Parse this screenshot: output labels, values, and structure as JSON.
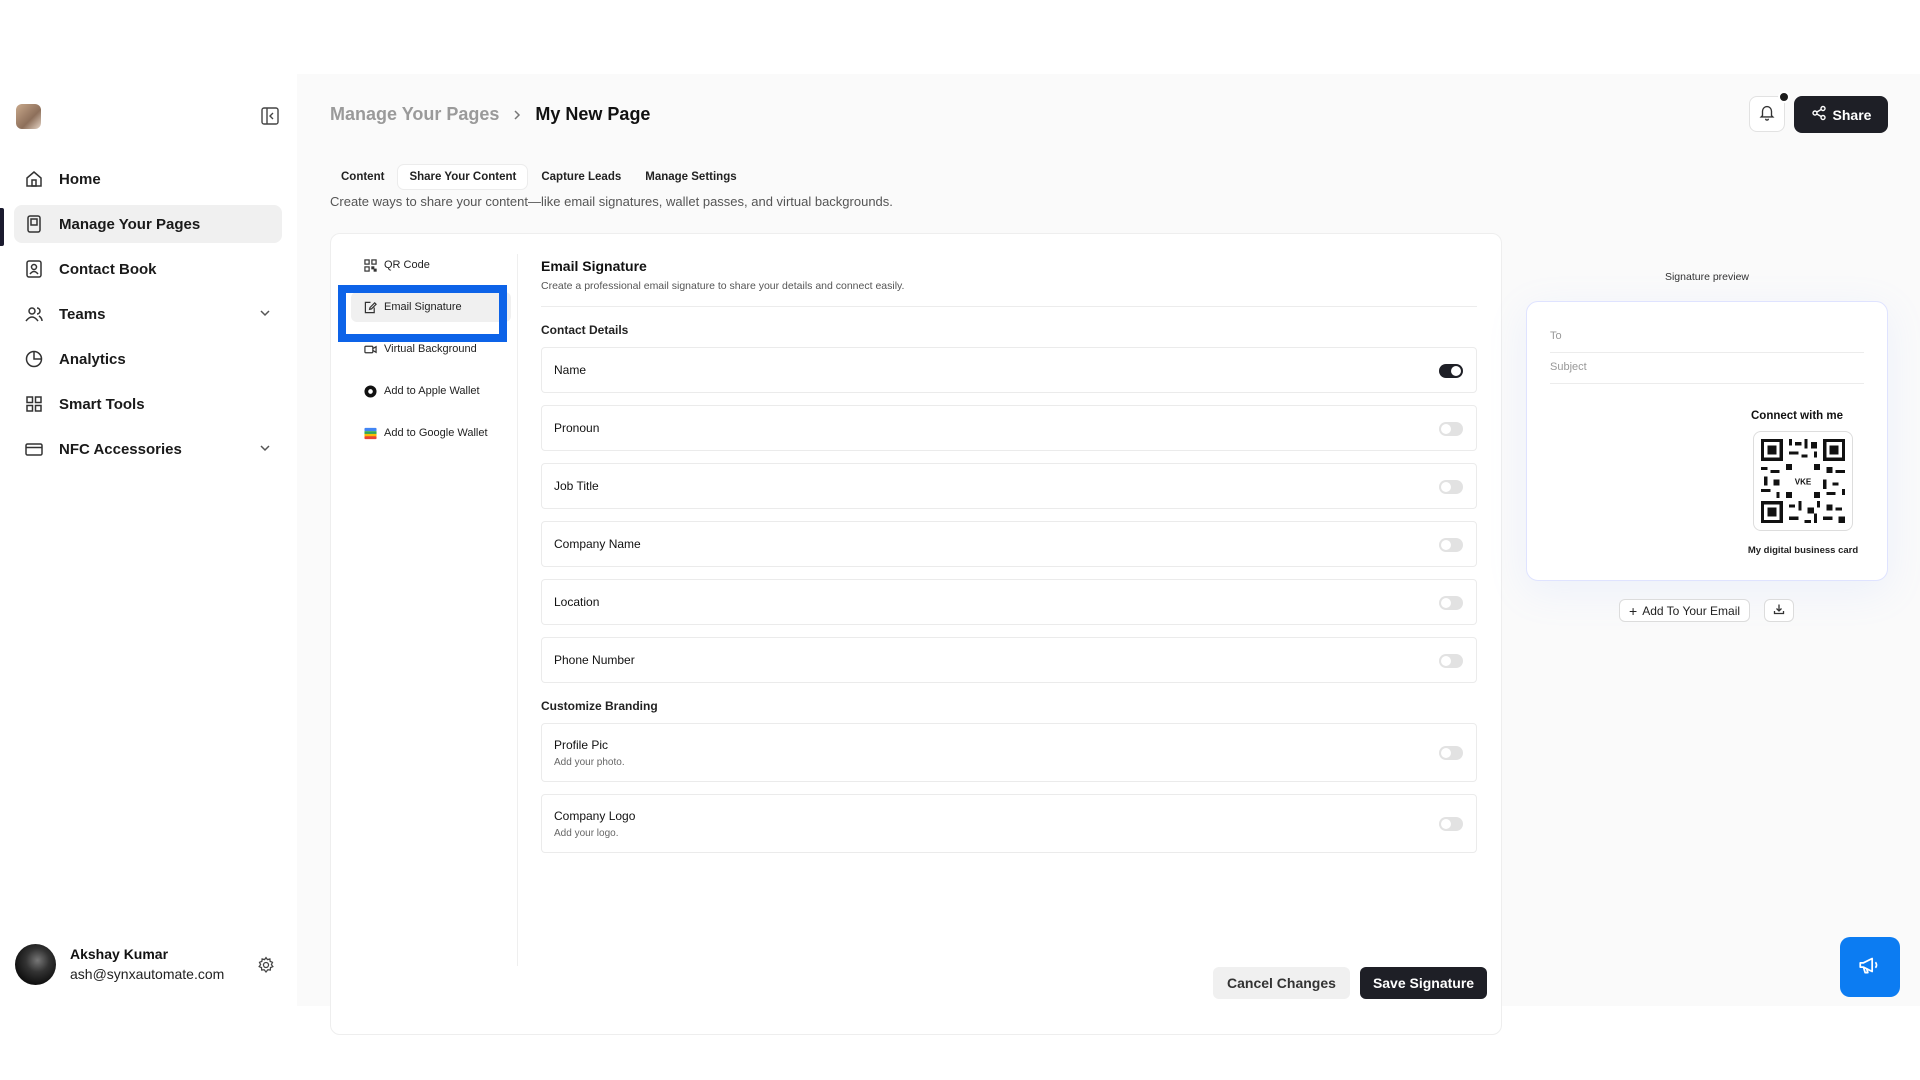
{
  "sidebar": {
    "items": [
      {
        "label": "Home",
        "icon": "home-icon"
      },
      {
        "label": "Manage Your Pages",
        "icon": "pages-icon"
      },
      {
        "label": "Contact Book",
        "icon": "contact-book-icon"
      },
      {
        "label": "Teams",
        "icon": "users-icon"
      },
      {
        "label": "Analytics",
        "icon": "analytics-icon"
      },
      {
        "label": "Smart Tools",
        "icon": "grid-icon"
      },
      {
        "label": "NFC Accessories",
        "icon": "card-icon"
      }
    ],
    "user": {
      "name": "Akshay Kumar",
      "email": "ash@synxautomate.com"
    }
  },
  "header": {
    "breadcrumb_parent": "Manage Your Pages",
    "breadcrumb_current": "My New Page",
    "share_label": "Share"
  },
  "tabs": {
    "items": [
      "Content",
      "Share Your Content",
      "Capture Leads",
      "Manage Settings"
    ],
    "description": "Create ways to share your content—like email signatures, wallet passes, and virtual backgrounds."
  },
  "share_nav": {
    "items": [
      "QR Code",
      "Email Signature",
      "Virtual Background",
      "Add to Apple Wallet",
      "Add to Google Wallet"
    ]
  },
  "form": {
    "title": "Email Signature",
    "subtitle": "Create a professional email signature to share your details and connect easily.",
    "contact_title": "Contact Details",
    "contact_fields": [
      {
        "label": "Name",
        "enabled": true
      },
      {
        "label": "Pronoun",
        "enabled": false
      },
      {
        "label": "Job Title",
        "enabled": false
      },
      {
        "label": "Company Name",
        "enabled": false
      },
      {
        "label": "Location",
        "enabled": false
      },
      {
        "label": "Phone Number",
        "enabled": false
      }
    ],
    "branding_title": "Customize Branding",
    "branding_fields": [
      {
        "label": "Profile Pic",
        "sub": "Add your photo.",
        "enabled": false
      },
      {
        "label": "Company Logo",
        "sub": "Add your logo.",
        "enabled": false
      }
    ],
    "cancel_label": "Cancel Changes",
    "save_label": "Save Signature"
  },
  "preview": {
    "title": "Signature preview",
    "to_placeholder": "To",
    "subject_placeholder": "Subject",
    "connect_text": "Connect with me",
    "qr_label": "VKE",
    "caption": "My digital business card",
    "add_label": "Add To Your Email"
  },
  "colors": {
    "accent": "#0d63e8",
    "dark": "#1e1f26",
    "fab": "#0c7cf2"
  }
}
